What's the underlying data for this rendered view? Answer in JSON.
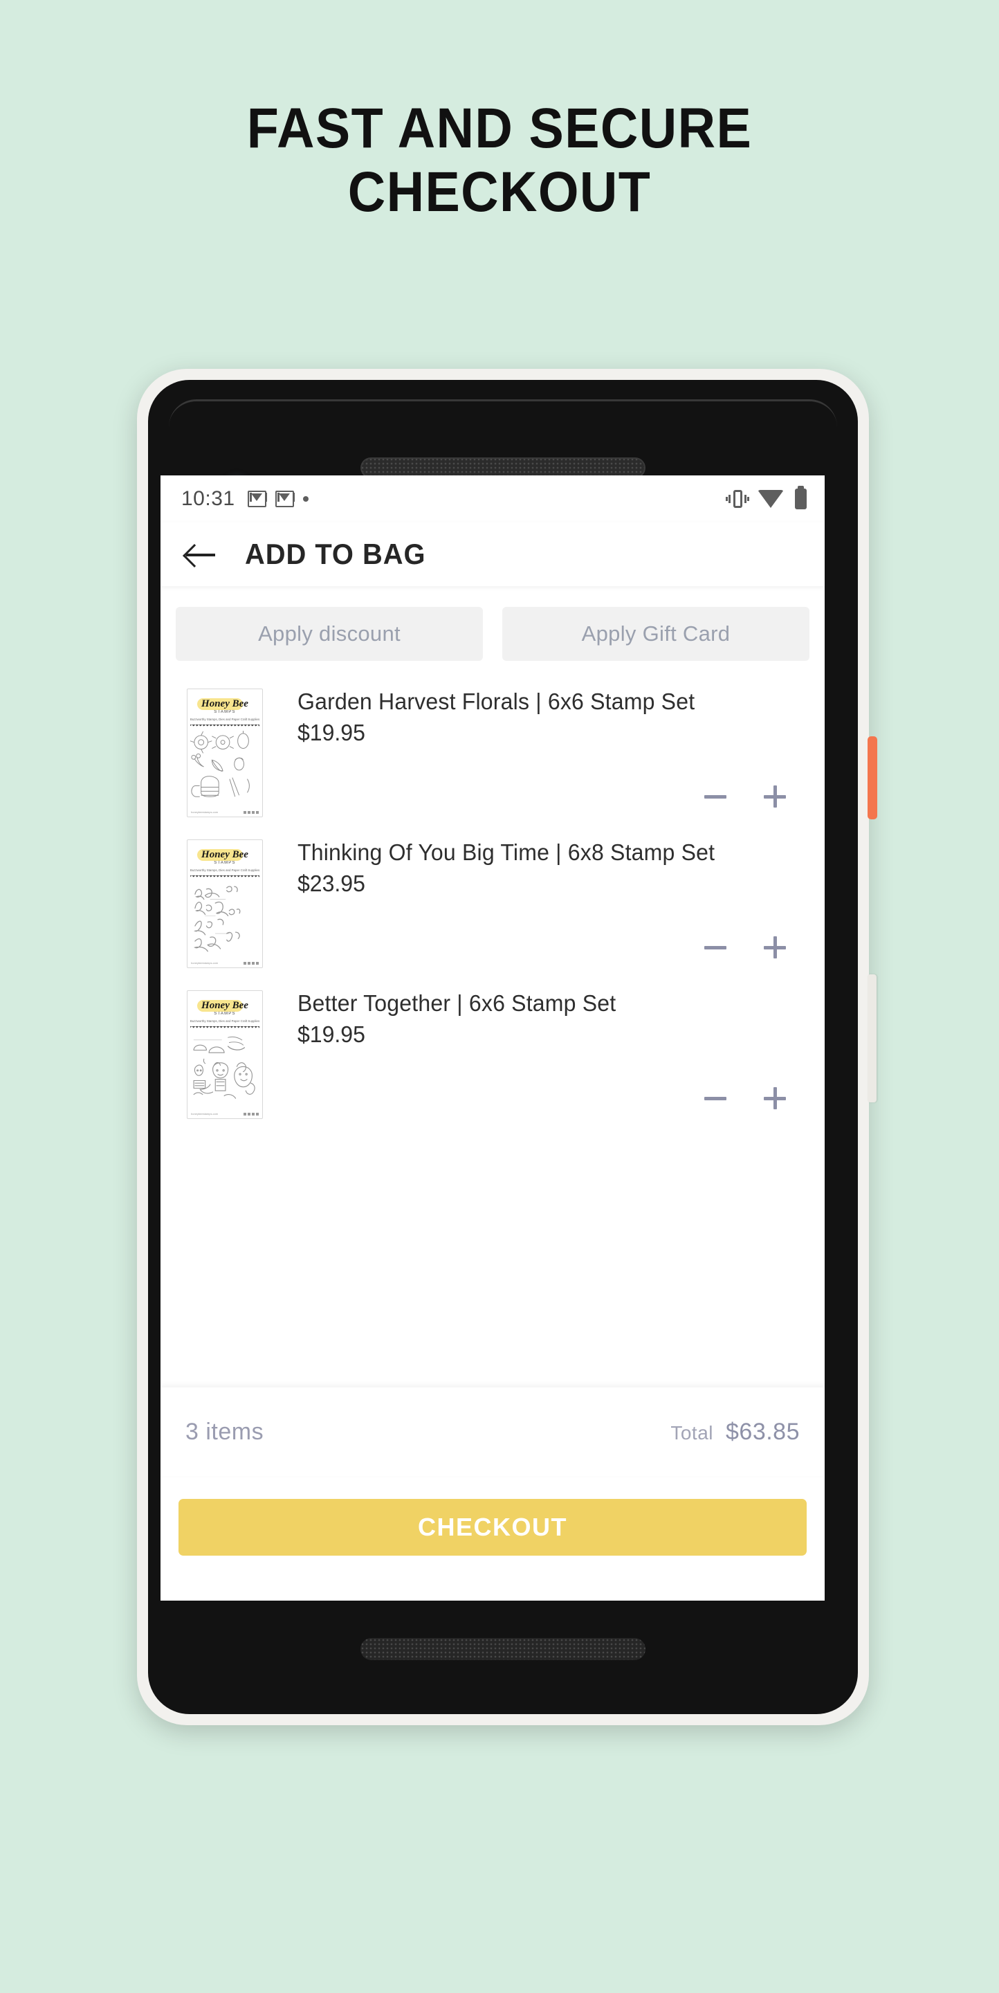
{
  "headline": {
    "line1": "FAST AND SECURE",
    "line2": "CHECKOUT"
  },
  "colors": {
    "background": "#d5ecdf",
    "checkout_button": "#f0d264",
    "power_button": "#f4764e",
    "muted_text": "#9a9cb0",
    "logo_highlight": "#f7e07a"
  },
  "phone": {
    "status_bar": {
      "time": "10:31",
      "left_icons": [
        "gmail-icon",
        "gmail-icon",
        "dot-icon"
      ],
      "right_icons": [
        "vibrate-icon",
        "wifi-icon",
        "battery-icon"
      ]
    },
    "app_bar": {
      "back_icon": "back-arrow-icon",
      "title": "ADD TO BAG"
    },
    "promo": {
      "discount_label": "Apply discount",
      "gift_card_label": "Apply Gift Card"
    },
    "cart": {
      "items": [
        {
          "name": "Garden Harvest Florals | 6x6 Stamp Set",
          "price": "$19.95",
          "thumb": {
            "brand": "Honey Bee",
            "brand_sub": "STAMPS",
            "tagline": "Buzzworthy Stamps, Dies and Paper Craft Supplies",
            "art": "floral-line-art"
          },
          "decrease_label": "minus-icon",
          "increase_label": "plus-icon"
        },
        {
          "name": "Thinking Of You Big Time | 6x8 Stamp Set",
          "price": "$23.95",
          "thumb": {
            "brand": "Honey Bee",
            "brand_sub": "STAMPS",
            "tagline": "Buzzworthy Stamps, Dies and Paper Craft Supplies",
            "art": "script-lettering-art"
          },
          "decrease_label": "minus-icon",
          "increase_label": "plus-icon"
        },
        {
          "name": "Better Together | 6x6 Stamp Set",
          "price": "$19.95",
          "thumb": {
            "brand": "Honey Bee",
            "brand_sub": "STAMPS",
            "tagline": "Buzzworthy Stamps, Dies and Paper Craft Supplies",
            "art": "animals-line-art"
          },
          "decrease_label": "minus-icon",
          "increase_label": "plus-icon"
        }
      ]
    },
    "totals": {
      "item_count": "3 items",
      "total_label": "Total",
      "total_value": "$63.85"
    },
    "checkout_label": "CHECKOUT"
  }
}
